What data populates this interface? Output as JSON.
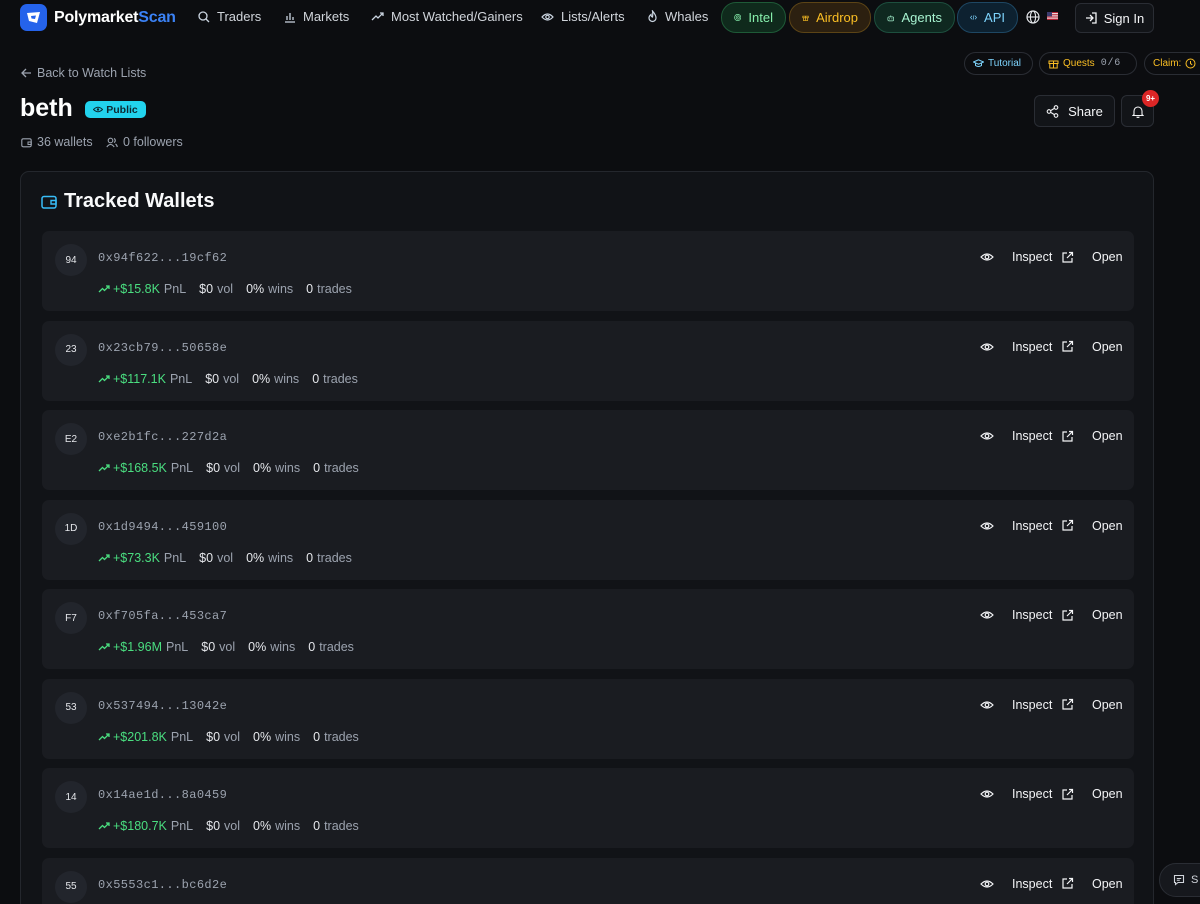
{
  "brand": {
    "name_main": "Polymarket",
    "name_accent": "Scan"
  },
  "nav": {
    "traders": "Traders",
    "markets": "Markets",
    "most_watched": "Most Watched/Gainers",
    "lists": "Lists/Alerts",
    "whales": "Whales",
    "intel": "Intel",
    "airdrop": "Airdrop",
    "agents": "Agents",
    "api": "API",
    "sign_in": "Sign In"
  },
  "quests_bar": {
    "tutorial": "Tutorial",
    "quests": "Quests",
    "quests_count": "0/6",
    "claim": "Claim:"
  },
  "page": {
    "back": "Back to Watch Lists",
    "title": "beth",
    "visibility": "Public",
    "wallets": "36 wallets",
    "followers": "0 followers",
    "share": "Share",
    "notification_badge": "9+"
  },
  "panel": {
    "title": "Tracked Wallets"
  },
  "labels": {
    "pnl": "PnL",
    "vol": "vol",
    "wins": "wins",
    "trades": "trades",
    "inspect": "Inspect",
    "open": "Open"
  },
  "wallets": [
    {
      "avatar": "94",
      "address": "0x94f622...19cf62",
      "pnl": "+$15.8K",
      "vol": "$0",
      "wins": "0%",
      "trades": "0"
    },
    {
      "avatar": "23",
      "address": "0x23cb79...50658e",
      "pnl": "+$117.1K",
      "vol": "$0",
      "wins": "0%",
      "trades": "0"
    },
    {
      "avatar": "E2",
      "address": "0xe2b1fc...227d2a",
      "pnl": "+$168.5K",
      "vol": "$0",
      "wins": "0%",
      "trades": "0"
    },
    {
      "avatar": "1D",
      "address": "0x1d9494...459100",
      "pnl": "+$73.3K",
      "vol": "$0",
      "wins": "0%",
      "trades": "0"
    },
    {
      "avatar": "F7",
      "address": "0xf705fa...453ca7",
      "pnl": "+$1.96M",
      "vol": "$0",
      "wins": "0%",
      "trades": "0"
    },
    {
      "avatar": "53",
      "address": "0x537494...13042e",
      "pnl": "+$201.8K",
      "vol": "$0",
      "wins": "0%",
      "trades": "0"
    },
    {
      "avatar": "14",
      "address": "0x14ae1d...8a0459",
      "pnl": "+$180.7K",
      "vol": "$0",
      "wins": "0%",
      "trades": "0"
    },
    {
      "avatar": "55",
      "address": "0x5553c1...bc6d2e"
    }
  ],
  "chat_widget": {
    "label": "S"
  },
  "colors": {
    "accent": "#3b82f6",
    "positive": "#4ade80",
    "public_badge": "#22d3ee",
    "bell_badge": "#dc2626"
  }
}
